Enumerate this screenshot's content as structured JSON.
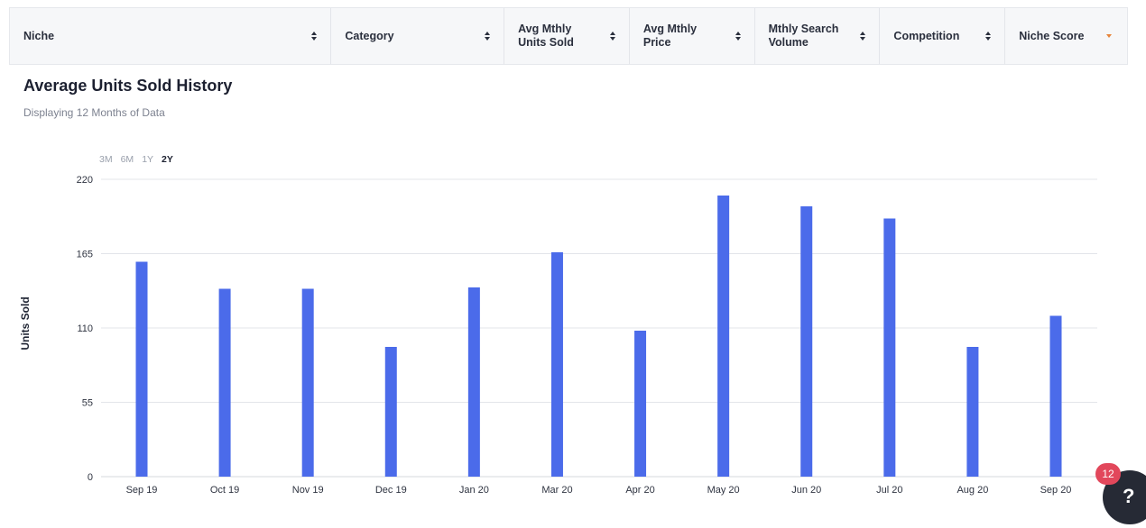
{
  "table_header": {
    "columns": [
      {
        "label": "Niche",
        "sort": "unsorted"
      },
      {
        "label": "Category",
        "sort": "unsorted"
      },
      {
        "label": "Avg Mthly Units Sold",
        "sort": "unsorted"
      },
      {
        "label": "Avg Mthly Price",
        "sort": "unsorted"
      },
      {
        "label": "Mthly Search Volume",
        "sort": "unsorted"
      },
      {
        "label": "Competition",
        "sort": "unsorted"
      },
      {
        "label": "Niche Score",
        "sort": "descending"
      }
    ]
  },
  "section": {
    "title": "Average Units Sold History",
    "subtitle": "Displaying 12 Months of Data"
  },
  "range_tabs": [
    "3M",
    "6M",
    "1Y",
    "2Y"
  ],
  "range_tab_active": "2Y",
  "colors": {
    "bar": "#4b6bea",
    "grid": "#e3e5ea",
    "sort_active": "#e8843a",
    "badge": "#e2475b"
  },
  "notification_badge": "12",
  "chart_data": {
    "type": "bar",
    "categories": [
      "Sep 19",
      "Oct 19",
      "Nov 19",
      "Dec 19",
      "Jan 20",
      "Mar 20",
      "Apr 20",
      "May 20",
      "Jun 20",
      "Jul 20",
      "Aug 20",
      "Sep 20"
    ],
    "series": [
      {
        "values": [
          159,
          139,
          139,
          96,
          140,
          166,
          108,
          208,
          200,
          191,
          96,
          119
        ]
      }
    ],
    "title": "Average Units Sold History",
    "subtitle": "Displaying 12 Months of Data",
    "xlabel": "",
    "ylabel": "Units Sold",
    "ylim": [
      0,
      220
    ],
    "yticks": [
      0,
      55,
      110,
      165,
      220
    ],
    "grid": true,
    "legend": "none"
  }
}
